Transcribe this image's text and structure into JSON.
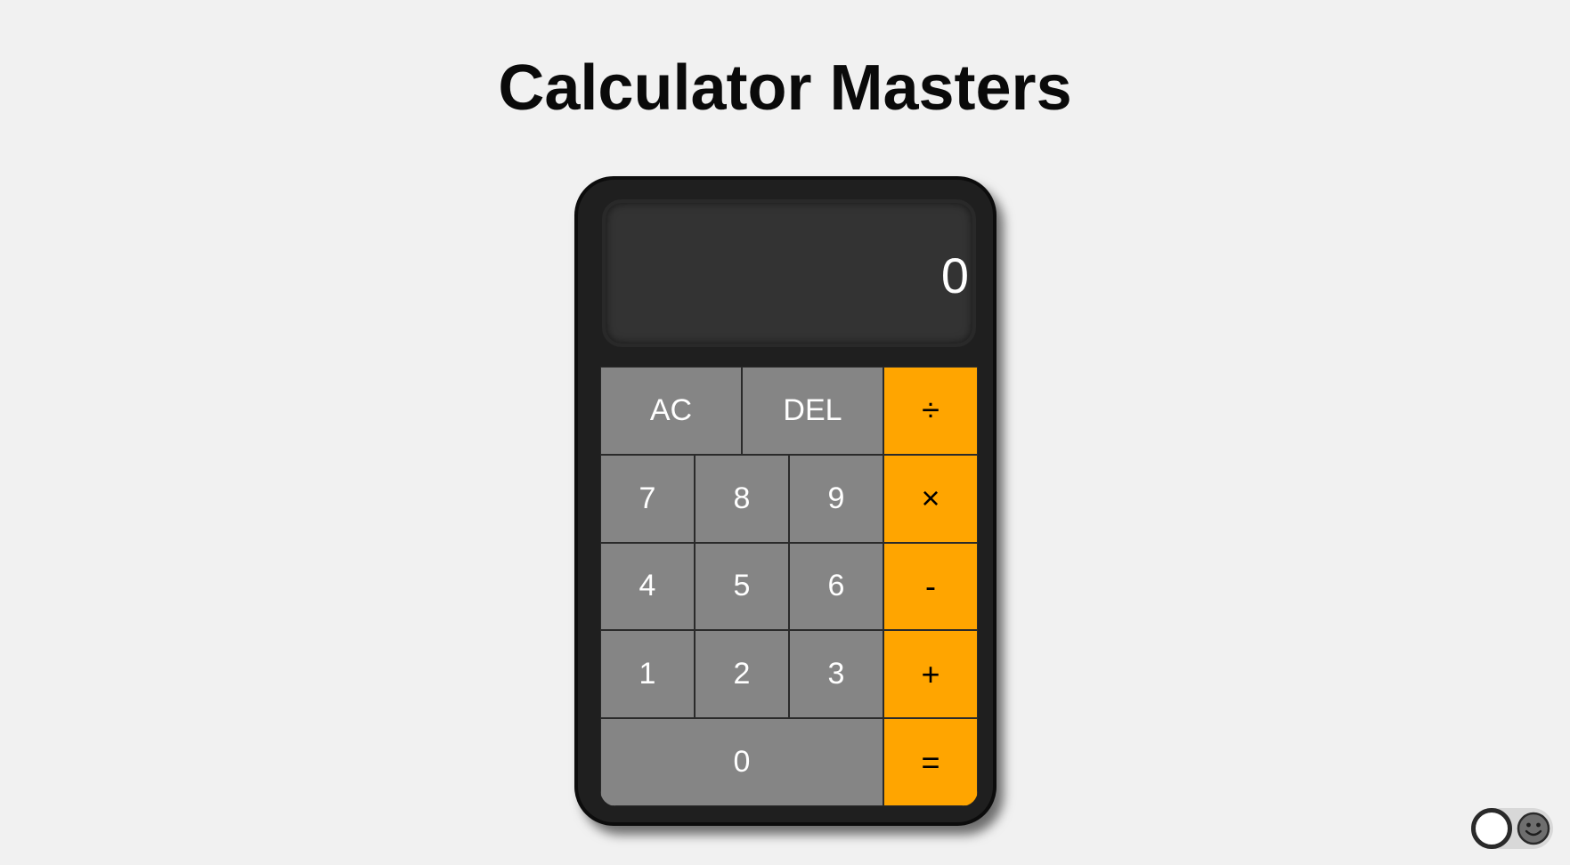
{
  "page": {
    "title": "Calculator Masters"
  },
  "display": {
    "value": "0"
  },
  "keys": {
    "ac": "AC",
    "del": "DEL",
    "divide": "÷",
    "seven": "7",
    "eight": "8",
    "nine": "9",
    "multiply": "×",
    "four": "4",
    "five": "5",
    "six": "6",
    "subtract": "-",
    "one": "1",
    "two": "2",
    "three": "3",
    "add": "+",
    "zero": "0",
    "equals": "="
  },
  "theme_toggle": {
    "icon": "smiley-face-icon",
    "state": "off"
  },
  "colors": {
    "background": "#f1f1f1",
    "calculator_body": "#1f1f1f",
    "display": "#333333",
    "number_key": "#858585",
    "operator_key": "#ffa500"
  }
}
